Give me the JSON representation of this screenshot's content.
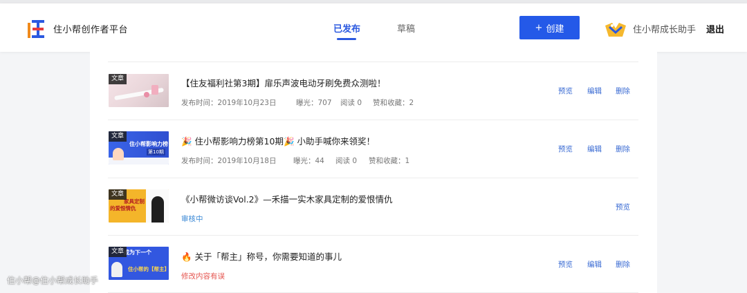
{
  "header": {
    "platform_name": "住小帮创作者平台",
    "tabs": [
      {
        "label": "已发布",
        "active": true
      },
      {
        "label": "草稿",
        "active": false
      }
    ],
    "create_button": {
      "icon": "+",
      "label": "创建"
    },
    "username": "住小帮成长助手",
    "logout": "退出"
  },
  "colors": {
    "accent": "#2459e8",
    "review": "#3c8ad6",
    "error": "#e5554f"
  },
  "articles": [
    {
      "tag": "文章",
      "title": "【住友福利社第3期】扉乐声波电动牙刷免费众测啦！",
      "meta": {
        "publish_time": "发布时间：2019年10月23日",
        "exposure": "曝光：707",
        "reads": "阅读 0",
        "likes": "赞和收藏：2"
      },
      "actions": [
        "预览",
        "编辑",
        "删除"
      ]
    },
    {
      "tag": "文章",
      "title": "🎉 住小帮影响力榜第10期🎉 小助手喊你来领奖！",
      "thumb_text": [
        "住小帮影响力榜",
        "第10期"
      ],
      "meta": {
        "publish_time": "发布时间：2019年10月18日",
        "exposure": "曝光：44",
        "reads": "阅读 0",
        "likes": "赞和收藏：1"
      },
      "actions": [
        "预览",
        "编辑",
        "删除"
      ]
    },
    {
      "tag": "文章",
      "title": "《小帮微访谈Vol.2》—禾描一实木家具定制的爱恨情仇",
      "thumb_text": [
        "家具定制",
        "的爱恨情仇"
      ],
      "status": "审核中",
      "actions": [
        "预览"
      ]
    },
    {
      "tag": "文章",
      "title": "🔥 关于「帮主」称号，你需要知道的事儿",
      "thumb_text": [
        "成为下一个",
        "住小帮的【帮主】"
      ],
      "status": "修改内容有误",
      "actions": [
        "预览",
        "编辑",
        "删除"
      ]
    }
  ],
  "watermark": "住小帮@住小帮成长助手"
}
